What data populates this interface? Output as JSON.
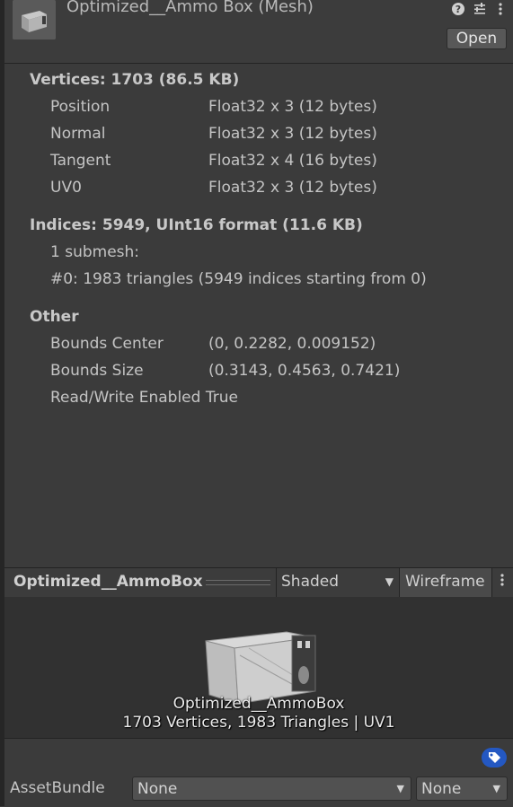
{
  "header": {
    "thumbnail_icon": "mesh-icon",
    "title": "Optimized__Ammo Box (Mesh)",
    "open_label": "Open",
    "icons": [
      "help-icon",
      "preset-icon",
      "more-icon"
    ]
  },
  "vertices": {
    "heading": "Vertices: 1703 (86.5 KB)",
    "attributes": [
      {
        "name": "Position",
        "format": "Float32 x 3 (12 bytes)"
      },
      {
        "name": "Normal",
        "format": "Float32 x 3 (12 bytes)"
      },
      {
        "name": "Tangent",
        "format": "Float32 x 4 (16 bytes)"
      },
      {
        "name": "UV0",
        "format": "Float32 x 3 (12 bytes)"
      }
    ]
  },
  "indices": {
    "heading": "Indices: 5949, UInt16 format (11.6 KB)",
    "submesh_count": "1 submesh:",
    "submesh_0": "#0: 1983 triangles (5949 indices starting from 0)"
  },
  "other": {
    "heading": "Other",
    "rows": [
      {
        "name": "Bounds Center",
        "value": "(0, 0.2282, 0.009152)"
      },
      {
        "name": "Bounds Size",
        "value": "(0.3143, 0.4563, 0.7421)"
      }
    ],
    "read_write": "Read/Write Enabled True"
  },
  "preview": {
    "name": "Optimized__AmmoBox",
    "shading_mode": "Shaded",
    "wireframe_label": "Wireframe",
    "caption_name": "Optimized__AmmoBox",
    "caption_stats": "1703 Vertices, 1983 Triangles | UV1"
  },
  "footer": {
    "assetbundle_label": "AssetBundle",
    "assetbundle_name": "None",
    "assetbundle_variant": "None"
  }
}
